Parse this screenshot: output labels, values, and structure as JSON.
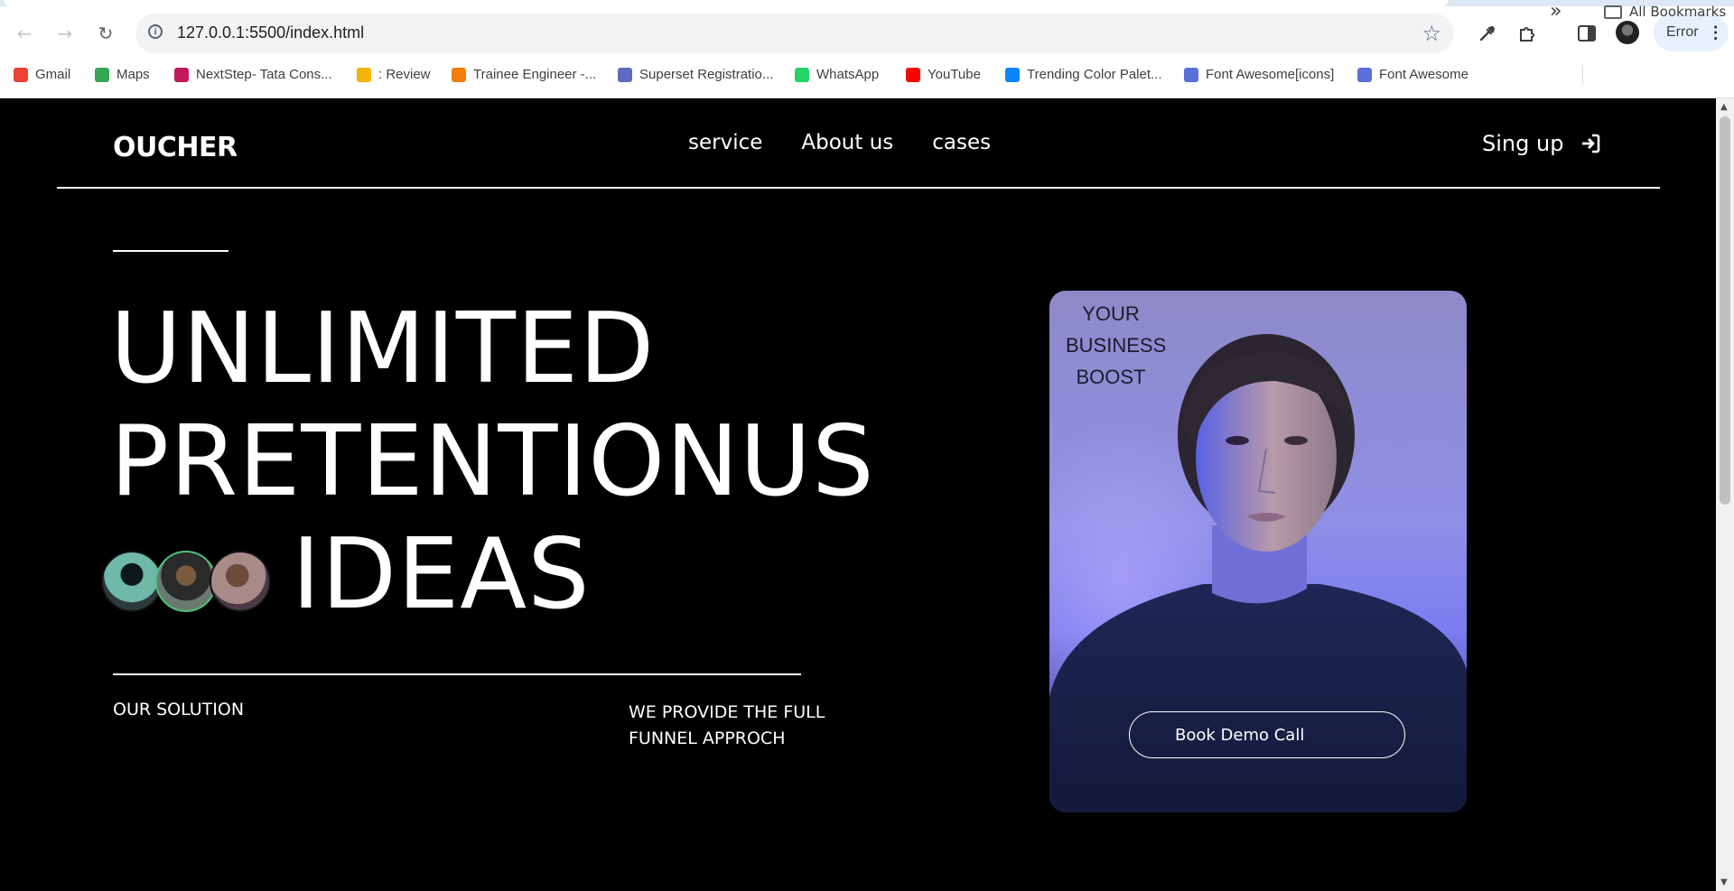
{
  "browser": {
    "url": "127.0.0.1:5500/index.html",
    "profile_status": "Error",
    "bookmarks": [
      {
        "label": "Gmail",
        "icon": "gmail-icon",
        "color": "#ea4335"
      },
      {
        "label": "Maps",
        "icon": "maps-icon",
        "color": "#34a853"
      },
      {
        "label": "NextStep- Tata Cons...",
        "icon": "tcs-icon",
        "color": "#c2185b"
      },
      {
        "label": ": Review",
        "icon": "review-icon",
        "color": "#f4b400"
      },
      {
        "label": "Trainee Engineer -...",
        "icon": "trainee-icon",
        "color": "#f57c00"
      },
      {
        "label": "Superset Registratio...",
        "icon": "superset-icon",
        "color": "#5c6bc0"
      },
      {
        "label": "WhatsApp",
        "icon": "whatsapp-icon",
        "color": "#25d366"
      },
      {
        "label": "YouTube",
        "icon": "youtube-icon",
        "color": "#ff0000"
      },
      {
        "label": "Trending Color Palet...",
        "icon": "coolors-icon",
        "color": "#0a84ff"
      },
      {
        "label": "Font Awesome[icons]",
        "icon": "flag-icon",
        "color": "#5b6fd8"
      },
      {
        "label": "Font Awesome",
        "icon": "flag-icon",
        "color": "#5b6fd8"
      }
    ],
    "all_bookmarks": "All Bookmarks"
  },
  "site": {
    "logo": "OUCHER",
    "nav": [
      "service",
      "About us",
      "cases"
    ],
    "signup": "Sing up"
  },
  "hero": {
    "line1": "UNLIMITED",
    "line2": "PRETENTIONUS",
    "line3": "IDEAS",
    "our_solution": "OUR SOLUTION",
    "provide": "WE PROVIDE THE FULL FUNNEL APPROCH"
  },
  "card": {
    "tag": "YOUR BUSINESS BOOST",
    "button": "Book Demo Call"
  }
}
